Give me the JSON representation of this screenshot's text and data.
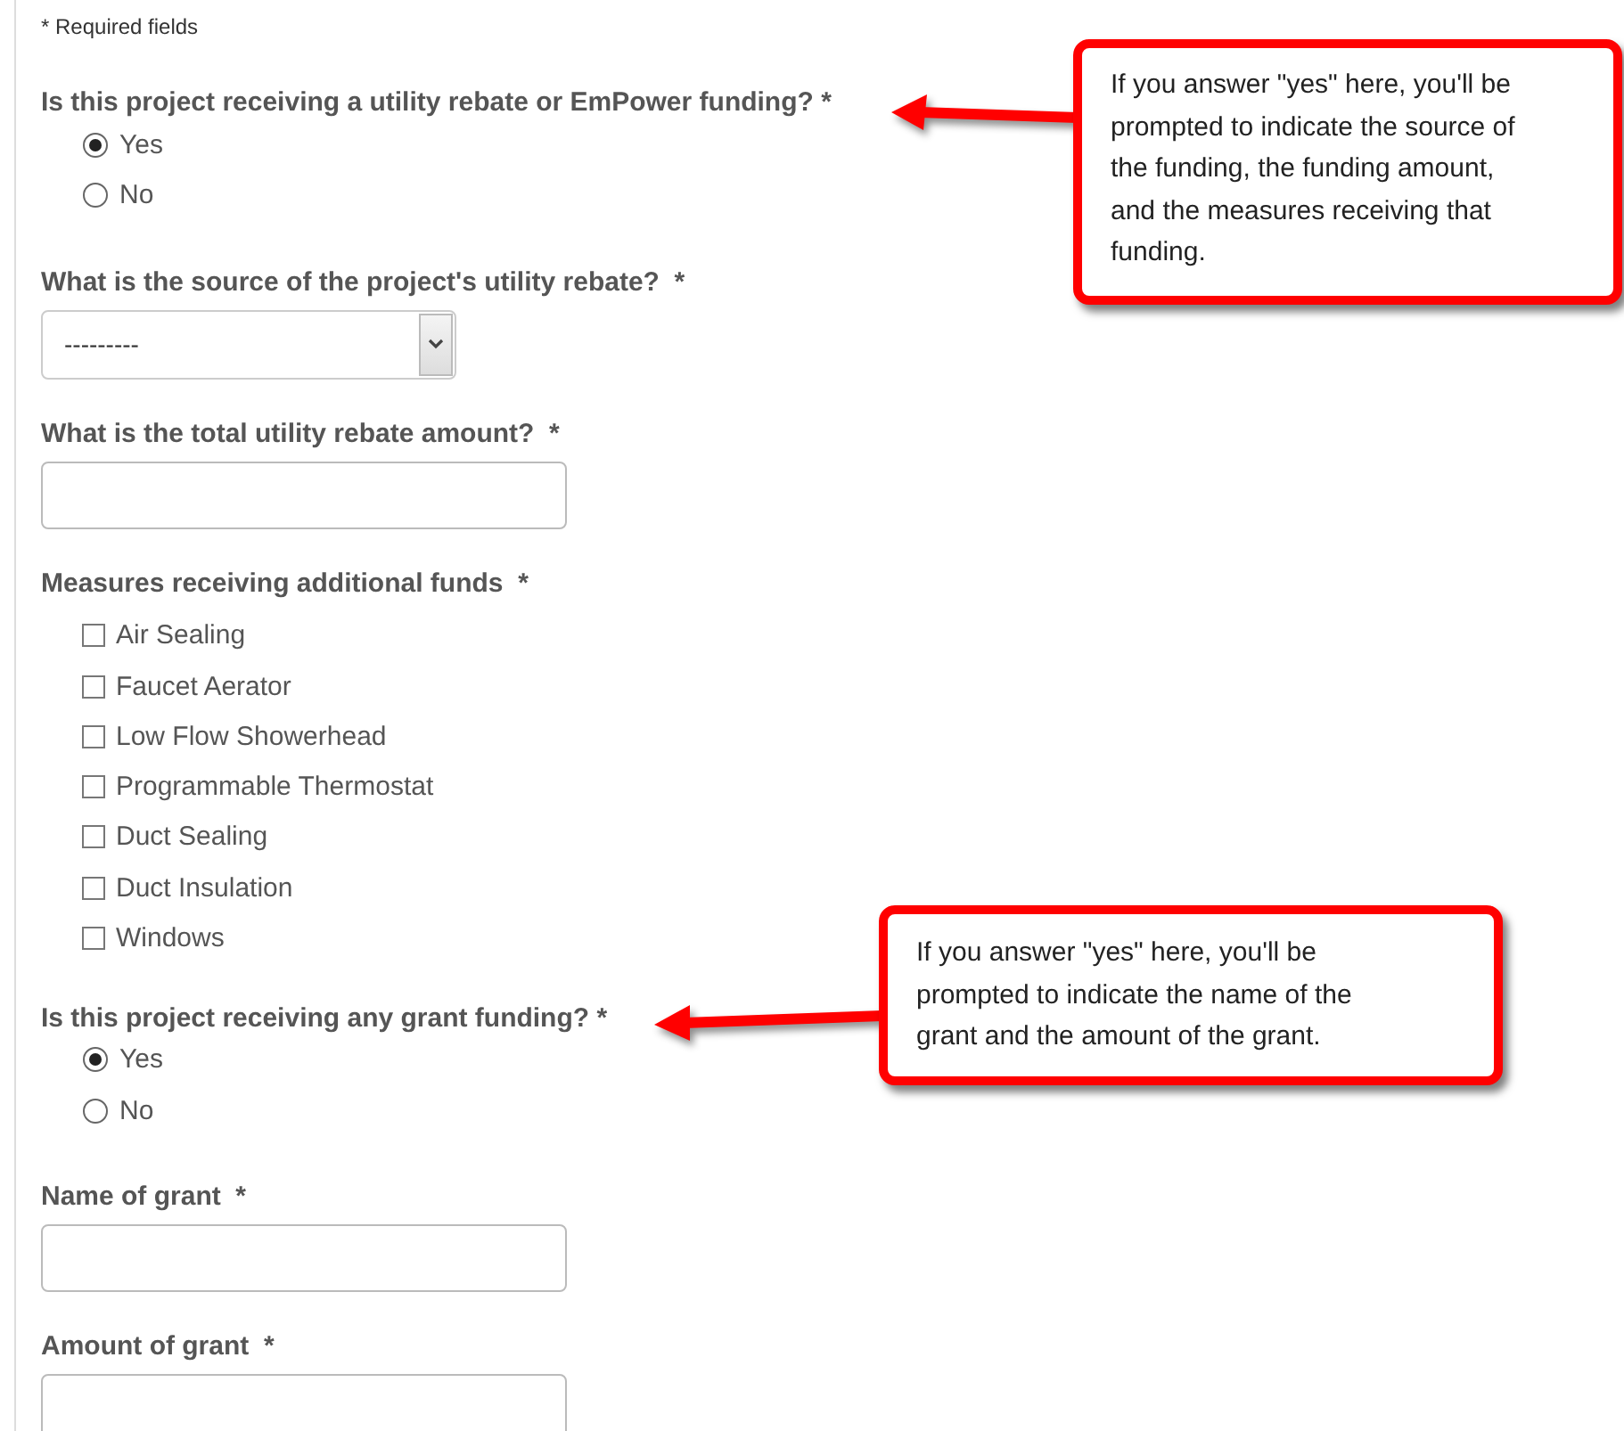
{
  "required_note": "* Required fields",
  "fields": [
    {
      "kind": "radio",
      "label": "Is this project receiving a utility rebate or EmPower funding? *",
      "options": [
        {
          "label": "Yes",
          "selected": true
        },
        {
          "label": "No",
          "selected": false
        }
      ]
    },
    {
      "kind": "select",
      "label": "What is the source of the project's utility rebate?  *",
      "value": "---------"
    },
    {
      "kind": "text",
      "label": "What is the total utility rebate amount?  *"
    },
    {
      "kind": "checkboxes",
      "label": "Measures receiving additional funds  *",
      "options": [
        {
          "label": "Air Sealing",
          "checked": false
        },
        {
          "label": "Faucet Aerator",
          "checked": false
        },
        {
          "label": "Low Flow Showerhead",
          "checked": false
        },
        {
          "label": "Programmable Thermostat",
          "checked": false
        },
        {
          "label": "Duct Sealing",
          "checked": false
        },
        {
          "label": "Duct Insulation",
          "checked": false
        },
        {
          "label": "Windows",
          "checked": false
        }
      ]
    },
    {
      "kind": "radio",
      "label": "Is this project receiving any grant funding? *",
      "options": [
        {
          "label": "Yes",
          "selected": true
        },
        {
          "label": "No",
          "selected": false
        }
      ]
    },
    {
      "kind": "text",
      "label": "Name of grant  *"
    },
    {
      "kind": "text",
      "label": "Amount of grant  *"
    }
  ],
  "callouts": [
    {
      "text": "If you answer \"yes\" here, you'll be prompted to indicate the source of the funding, the funding amount, and the measures receiving that funding."
    },
    {
      "text": "If you answer \"yes\" here, you'll be prompted to indicate the name of the grant and the amount of the grant."
    }
  ]
}
